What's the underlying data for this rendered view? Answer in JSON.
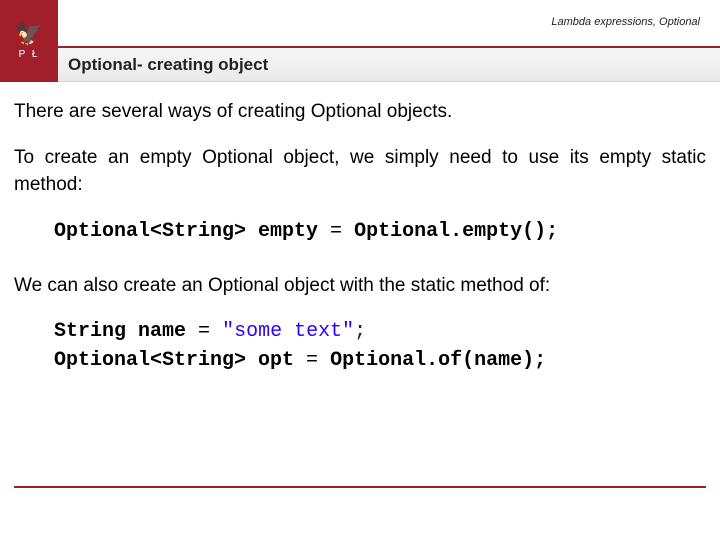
{
  "header": {
    "breadcrumb": "Lambda expressions, Optional",
    "logo_glyph": "🦅",
    "logo_letters": "P  Ł",
    "title": "Optional- creating object"
  },
  "body": {
    "p1": "There are several ways of creating Optional objects.",
    "p2": "To create an empty Optional object, we simply need to use its empty static method:",
    "p3": "We can also create an Optional object with the static method of:"
  },
  "code1": {
    "t1": "Optional<String> empty ",
    "eq": "=",
    "t2": " Optional.empty();"
  },
  "code2": {
    "l1a": "String name ",
    "l1eq": "=",
    "l1b": " ",
    "l1str": "\"some text\"",
    "l1c": ";",
    "l2a": "Optional<String> opt ",
    "l2eq": "=",
    "l2b": " Optional.of(name);"
  }
}
